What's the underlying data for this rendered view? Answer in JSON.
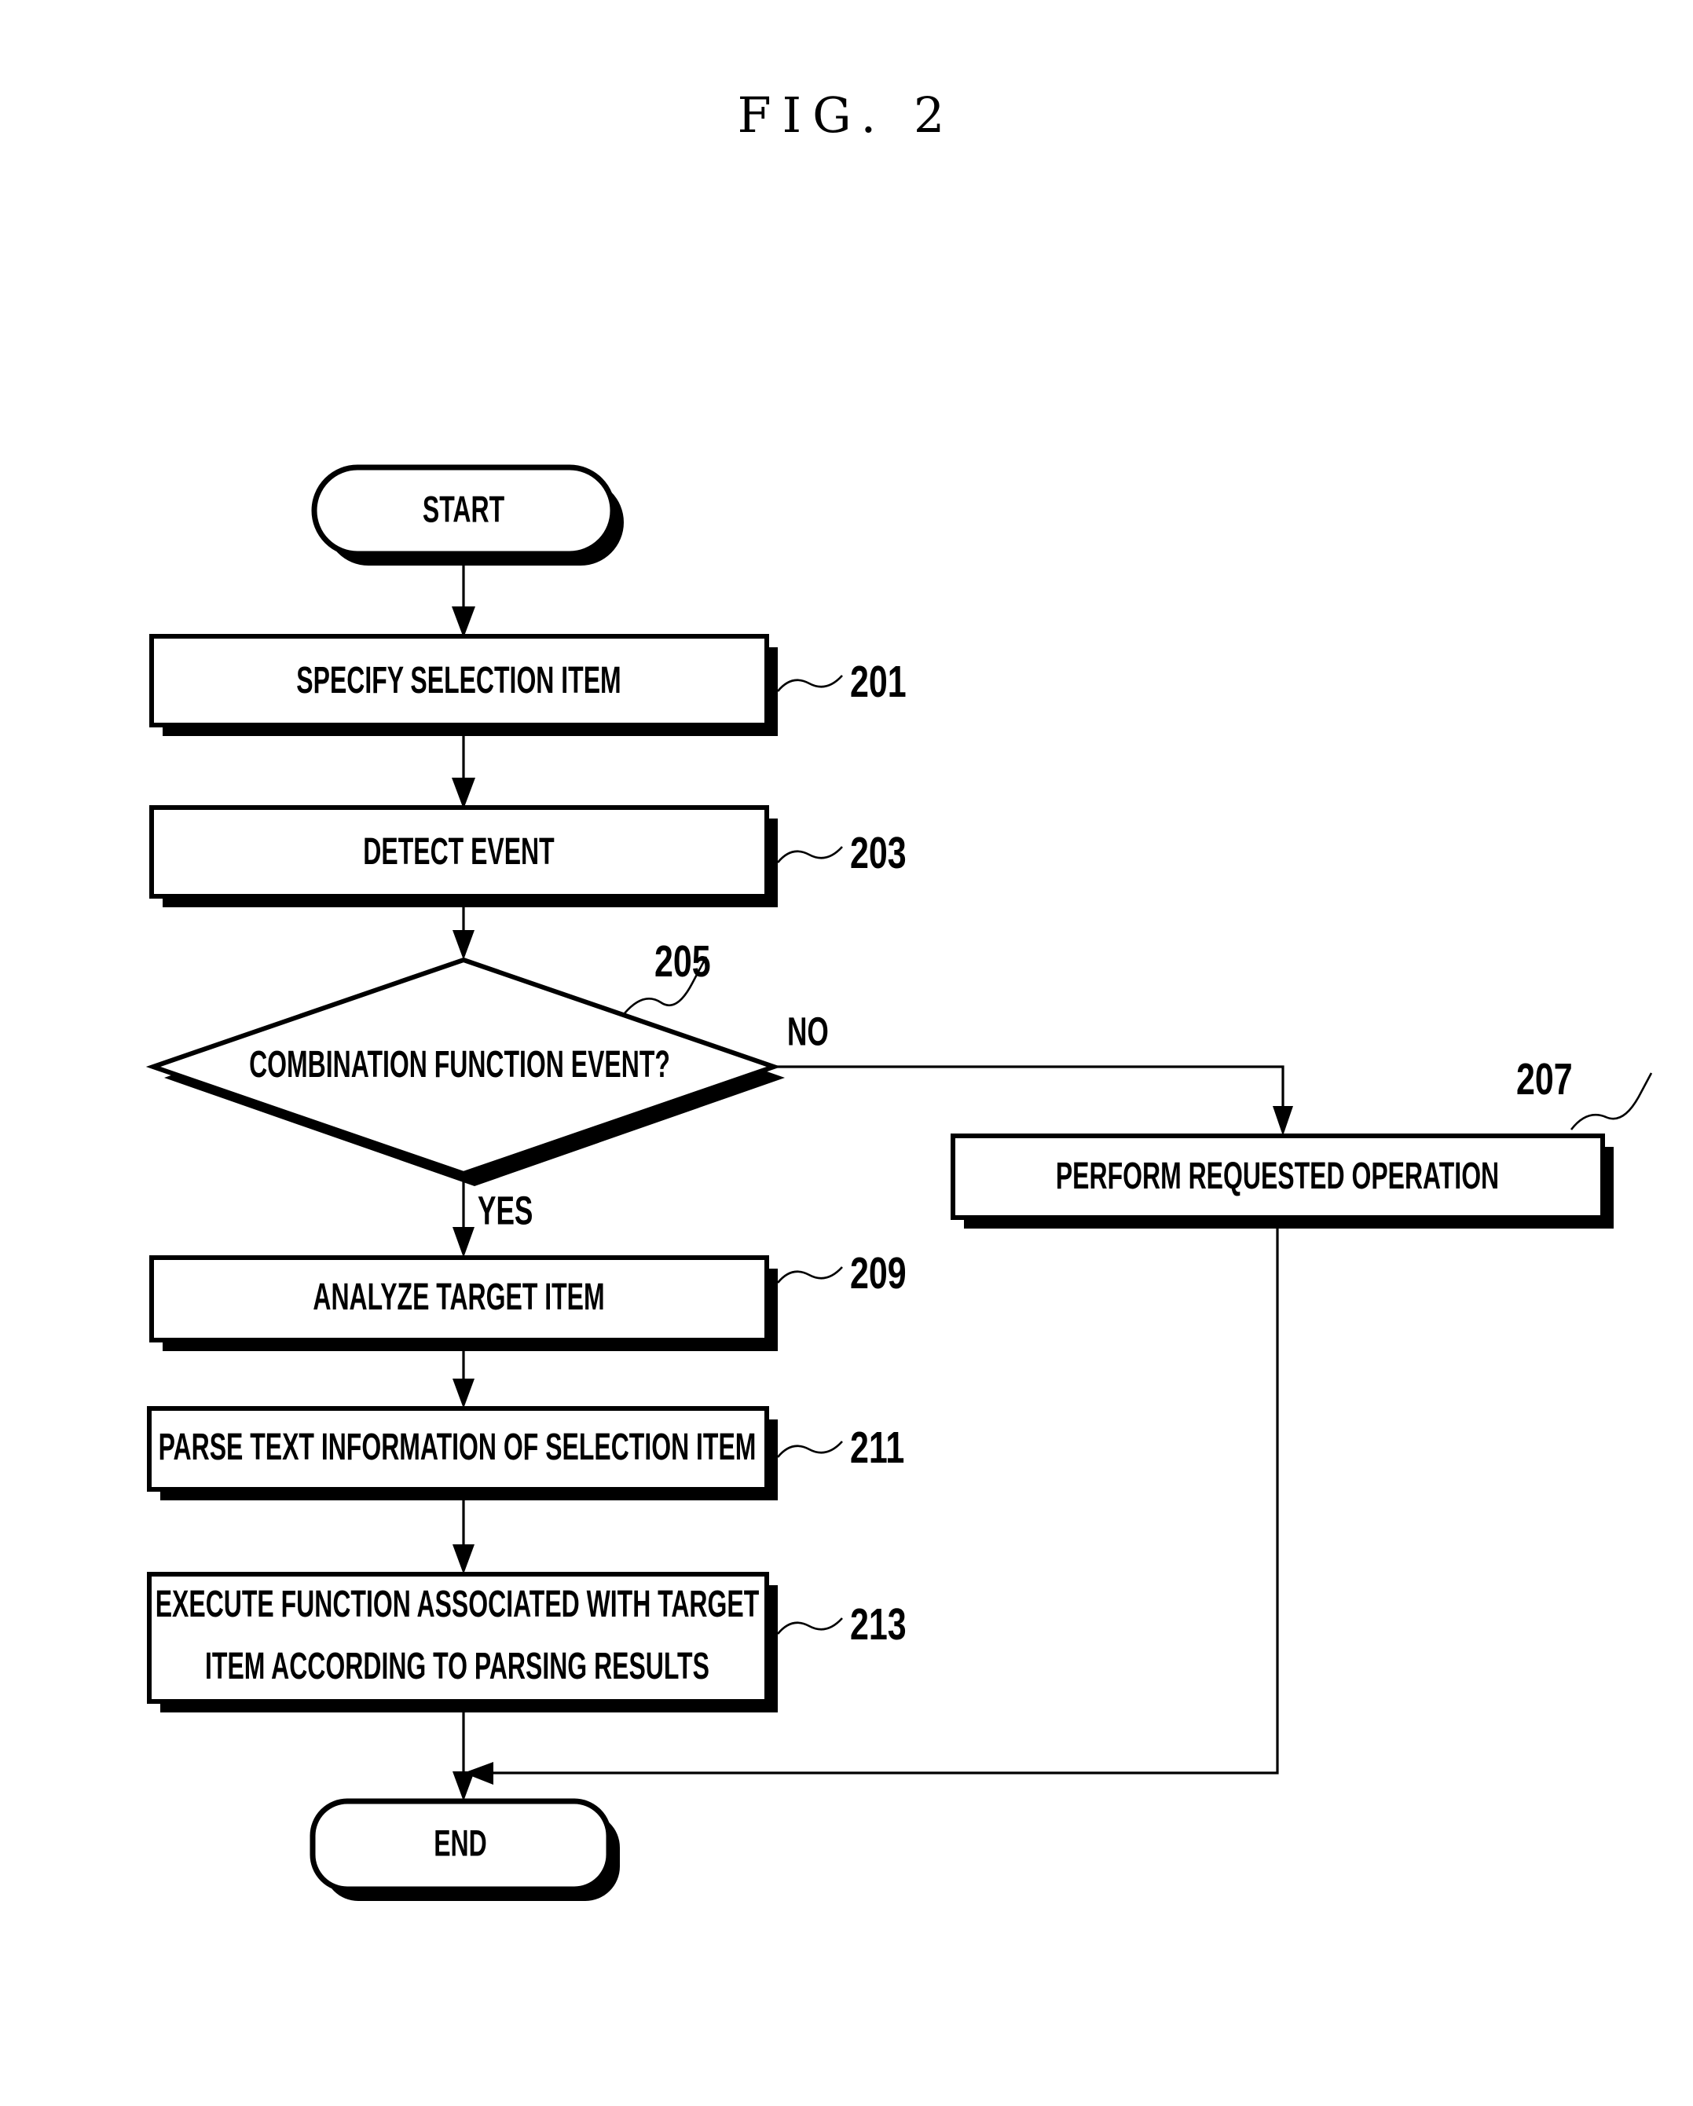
{
  "figure": {
    "title": "FIG. 2",
    "type": "flowchart",
    "background_color": "#ffffff",
    "line_color": "#000000"
  },
  "nodes": {
    "start": {
      "label": "START",
      "shape": "terminator",
      "ref": ""
    },
    "specify_selection_item": {
      "label": "SPECIFY SELECTION ITEM",
      "shape": "process",
      "ref": "201"
    },
    "detect_event": {
      "label": "DETECT EVENT",
      "shape": "process",
      "ref": "203"
    },
    "combination_function_event": {
      "label": "COMBINATION FUNCTION EVENT?",
      "shape": "decision",
      "ref": "205"
    },
    "perform_requested_operation": {
      "label": "PERFORM REQUESTED OPERATION",
      "shape": "process",
      "ref": "207"
    },
    "analyze_target_item": {
      "label": "ANALYZE TARGET ITEM",
      "shape": "process",
      "ref": "209"
    },
    "parse_text_information": {
      "label": "PARSE TEXT INFORMATION OF SELECTION ITEM",
      "shape": "process",
      "ref": "211"
    },
    "execute_function": {
      "label_line1": "EXECUTE FUNCTION ASSOCIATED WITH TARGET",
      "label_line2": "ITEM ACCORDING TO PARSING RESULTS",
      "shape": "process",
      "ref": "213"
    },
    "end": {
      "label": "END",
      "shape": "terminator",
      "ref": ""
    }
  },
  "edge_labels": {
    "decision_no": "NO",
    "decision_yes": "YES"
  },
  "reference_numerals": [
    "201",
    "203",
    "205",
    "207",
    "209",
    "211",
    "213"
  ]
}
